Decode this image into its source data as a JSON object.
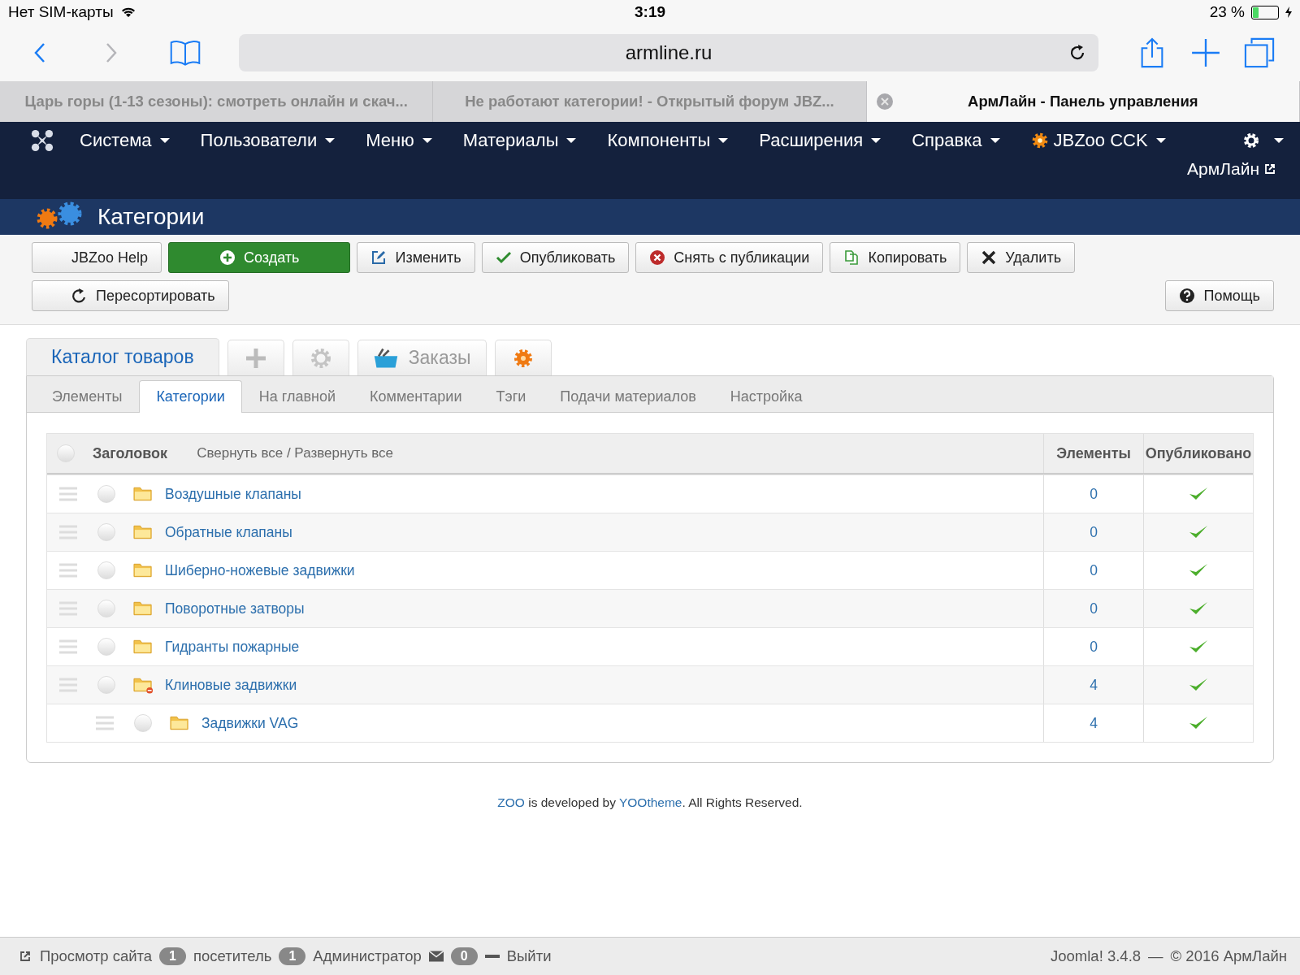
{
  "status_bar": {
    "carrier": "Нет SIM-карты",
    "time": "3:19",
    "battery_text": "23 %",
    "battery": {
      "level": 0.23
    }
  },
  "browser": {
    "url": "armline.ru",
    "tabs": [
      {
        "title": "Царь горы (1-13 сезоны): смотреть онлайн и скач...",
        "selected": false
      },
      {
        "title": "Не работают категории! - Открытый форум JBZ...",
        "selected": false
      },
      {
        "title": "АрмЛайн - Панель управления",
        "selected": true
      }
    ]
  },
  "nav": {
    "items": [
      {
        "label": "Система",
        "icon": false
      },
      {
        "label": "Пользователи",
        "icon": false
      },
      {
        "label": "Меню",
        "icon": false
      },
      {
        "label": "Материалы",
        "icon": false
      },
      {
        "label": "Компоненты",
        "icon": false
      },
      {
        "label": "Расширения",
        "icon": false
      },
      {
        "label": "Справка",
        "icon": false
      },
      {
        "label": "JBZoo CCK",
        "icon": true
      }
    ],
    "site_link": "АрмЛайн"
  },
  "page_header": {
    "title": "Категории"
  },
  "toolbar": {
    "buttons": [
      {
        "label": "JBZoo Help",
        "kind": "plain"
      },
      {
        "label": "Создать",
        "kind": "create"
      },
      {
        "label": "Изменить",
        "kind": "edit"
      },
      {
        "label": "Опубликовать",
        "kind": "publish"
      },
      {
        "label": "Снять с публикации",
        "kind": "unpublish"
      },
      {
        "label": "Копировать",
        "kind": "copy"
      },
      {
        "label": "Удалить",
        "kind": "delete"
      },
      {
        "label": "Пересортировать",
        "kind": "refresh"
      }
    ],
    "help_button": "Помощь"
  },
  "app_tabs": [
    {
      "kind": "text",
      "label": "Каталог товаров",
      "selected": true
    },
    {
      "kind": "plus",
      "selected": false
    },
    {
      "kind": "gear",
      "selected": false
    },
    {
      "kind": "basket",
      "label": "Заказы",
      "selected": false
    },
    {
      "kind": "jbzoo",
      "selected": false
    }
  ],
  "sub_tabs": [
    {
      "label": "Элементы",
      "selected": false
    },
    {
      "label": "Категории",
      "selected": true
    },
    {
      "label": "На главной",
      "selected": false
    },
    {
      "label": "Комментарии",
      "selected": false
    },
    {
      "label": "Тэги",
      "selected": false
    },
    {
      "label": "Подачи материалов",
      "selected": false
    },
    {
      "label": "Настройка",
      "selected": false
    }
  ],
  "table": {
    "columns": {
      "title": "Заголовок",
      "toggle": "Свернуть все / Развернуть все",
      "items": "Элементы",
      "published": "Опубликовано"
    },
    "select_all": {
      "selected": false
    },
    "rows": [
      {
        "name": "Воздушные клапаны",
        "items": "0",
        "published": true,
        "selected": false
      },
      {
        "name": "Обратные клапаны",
        "items": "0",
        "published": true,
        "selected": false
      },
      {
        "name": "Шиберно-ножевые задвижки",
        "items": "0",
        "published": true,
        "selected": false
      },
      {
        "name": "Поворотные затворы",
        "items": "0",
        "published": true,
        "selected": false
      },
      {
        "name": "Гидранты пожарные",
        "items": "0",
        "published": true,
        "selected": false
      },
      {
        "name": "Клиновые задвижки",
        "items": "4",
        "published": true,
        "selected": false,
        "expanded": true,
        "children": [
          {
            "name": "Задвижки VAG",
            "items": "4",
            "published": true,
            "selected": false
          }
        ]
      }
    ]
  },
  "credit": {
    "zoo": "ZOO",
    "middle": " is developed by ",
    "yootheme": "YOOtheme",
    "end": ". All Rights Reserved."
  },
  "footer": {
    "view_site": "Просмотр сайта",
    "visitors_count": "1",
    "visitors_label": "посетитель",
    "admins_count": "1",
    "admins_label": "Администратор",
    "messages_count": "0",
    "logout": "Выйти",
    "version": "Joomla! 3.4.8",
    "separator": "—",
    "copyright": "© 2016 АрмЛайн"
  }
}
